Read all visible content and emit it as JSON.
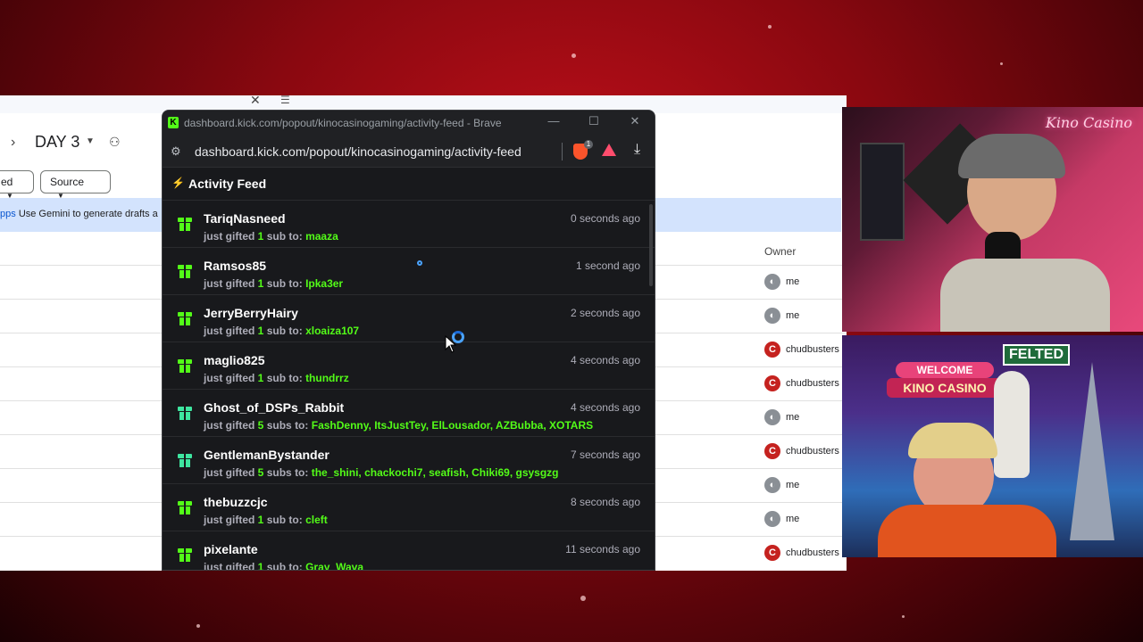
{
  "doc_bg": {
    "day_label": "DAY 3",
    "chip_left": "ed",
    "chip_source": "Source",
    "gemini_text_prefix": "pps",
    "gemini_text": "Use Gemini to generate drafts a",
    "owner_header": "Owner",
    "owners": [
      "me",
      "me",
      "chudbusters",
      "chudbusters",
      "me",
      "chudbusters",
      "me",
      "me",
      "chudbusters"
    ]
  },
  "popout": {
    "window_title": "dashboard.kick.com/popout/kinocasinogaming/activity-feed - Brave",
    "url": "dashboard.kick.com/popout/kinocasinogaming/activity-feed",
    "shield_count": "1",
    "header_title": "Activity Feed",
    "gift_phrase": "just gifted",
    "to_phrase": "to:",
    "feed": [
      {
        "user": "TariqNasneed",
        "count": "1",
        "unit": "sub",
        "recipients": "maaza",
        "time": "0 seconds ago",
        "icon": "gift-icon"
      },
      {
        "user": "Ramsos85",
        "count": "1",
        "unit": "sub",
        "recipients": "Ipka3er",
        "time": "1 second ago",
        "icon": "gift-icon"
      },
      {
        "user": "JerryBerryHairy",
        "count": "1",
        "unit": "sub",
        "recipients": "xloaiza107",
        "time": "2 seconds ago",
        "icon": "gift-icon"
      },
      {
        "user": "maglio825",
        "count": "1",
        "unit": "sub",
        "recipients": "thundrrz",
        "time": "4 seconds ago",
        "icon": "gift-icon"
      },
      {
        "user": "Ghost_of_DSPs_Rabbit",
        "count": "5",
        "unit": "subs",
        "recipients": "FashDenny, ItsJustTey, ElLousador, AZBubba, XOTARS",
        "time": "4 seconds ago",
        "icon": "gift-icon-teal"
      },
      {
        "user": "GentlemanBystander",
        "count": "5",
        "unit": "subs",
        "recipients": "the_shini, chackochi7, seafish, Chiki69, gsysgzg",
        "time": "7 seconds ago",
        "icon": "gift-icon-teal"
      },
      {
        "user": "thebuzzcjc",
        "count": "1",
        "unit": "sub",
        "recipients": "cleft",
        "time": "8 seconds ago",
        "icon": "gift-icon"
      },
      {
        "user": "pixelante",
        "count": "1",
        "unit": "sub",
        "recipients": "Gray_Wava",
        "time": "11 seconds ago",
        "icon": "gift-icon"
      }
    ]
  },
  "cams": {
    "brand": "Kino Casino",
    "welcome": "WELCOME",
    "kino_sign": "KINO CASINO",
    "felted": "FELTED"
  },
  "colors": {
    "kick_green": "#53fc18",
    "feed_bg": "#18191c",
    "stream_red": "#c0101a"
  }
}
